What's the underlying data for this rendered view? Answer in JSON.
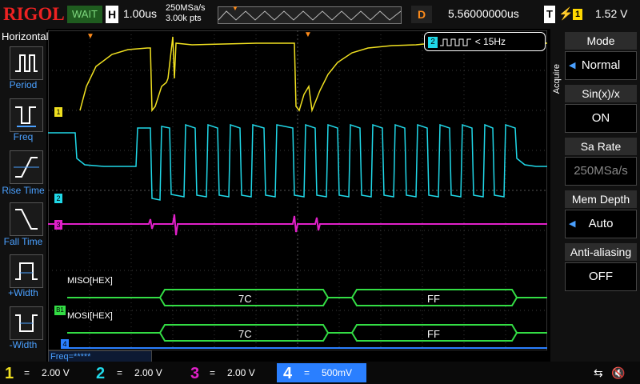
{
  "brand": "RIGOL",
  "status": "WAIT",
  "horizontal": {
    "badge": "H",
    "timebase": "1.00us",
    "sample_rate": "250MSa/s",
    "points": "3.00k pts"
  },
  "delay": {
    "badge": "D",
    "value": "5.56000000us"
  },
  "trigger": {
    "badge": "T",
    "channel": "1",
    "level": "1.52 V"
  },
  "left_menu": {
    "title": "Horizontal",
    "items": [
      {
        "label": "Period"
      },
      {
        "label": "Freq"
      },
      {
        "label": "Rise Time"
      },
      {
        "label": "Fall Time"
      },
      {
        "label": "+Width"
      },
      {
        "label": "-Width"
      }
    ]
  },
  "right_menu": {
    "section": "Acquire",
    "items": [
      {
        "title": "Mode",
        "value": "Normal"
      },
      {
        "title": "Sin(x)/x",
        "value": "ON"
      },
      {
        "title": "Sa Rate",
        "value": "250MSa/s"
      },
      {
        "title": "Mem Depth",
        "value": "Auto"
      },
      {
        "title": "Anti-aliasing",
        "value": "OFF"
      }
    ]
  },
  "freq_counter": {
    "channel": "2",
    "value": "< 15Hz"
  },
  "freq_meas": "Freq=*****",
  "decode": {
    "miso_label": "MISO[HEX]",
    "mosi_label": "MOSI[HEX]",
    "miso_values": [
      "7C",
      "FF"
    ],
    "mosi_values": [
      "7C",
      "FF"
    ],
    "bus_marker": "B1"
  },
  "channels": [
    {
      "num": "1",
      "scale": "2.00 V",
      "color": "#f0e020"
    },
    {
      "num": "2",
      "scale": "2.00 V",
      "color": "#20d8e8"
    },
    {
      "num": "3",
      "scale": "2.00 V",
      "color": "#e020c8"
    },
    {
      "num": "4",
      "scale": "500mV",
      "color": "#2a7fff"
    }
  ],
  "colors": {
    "ch1": "#f0e020",
    "ch2": "#20d8e8",
    "ch3": "#e020c8",
    "ch4": "#2a7fff",
    "decode": "#33dd44",
    "accent": "#ff8c1a"
  }
}
